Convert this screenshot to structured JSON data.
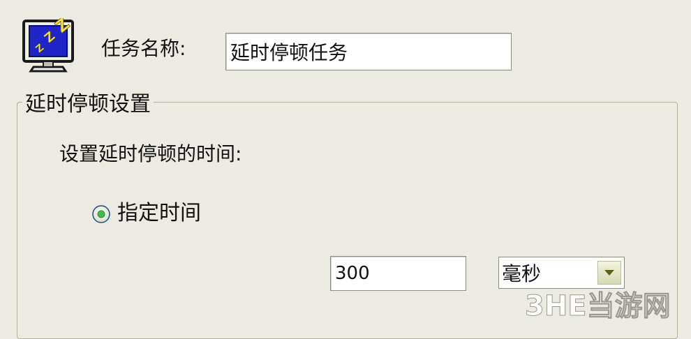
{
  "task": {
    "name_label": "任务名称:",
    "name_value": "延时停顿任务",
    "icon": "sleep-monitor-icon"
  },
  "delay_group": {
    "title": "延时停顿设置",
    "prompt": "设置延时停顿的时间:",
    "radio_specify_label": "指定时间",
    "radio_specify_checked": true,
    "time_value": "300",
    "unit_selected": "毫秒"
  },
  "watermark": {
    "text": "3HE当游网"
  },
  "colors": {
    "background": "#ecebe3",
    "group_border": "#b3b09c",
    "radio_dot": "#3fbf47",
    "dropdown_arrow": "#5b6118"
  }
}
